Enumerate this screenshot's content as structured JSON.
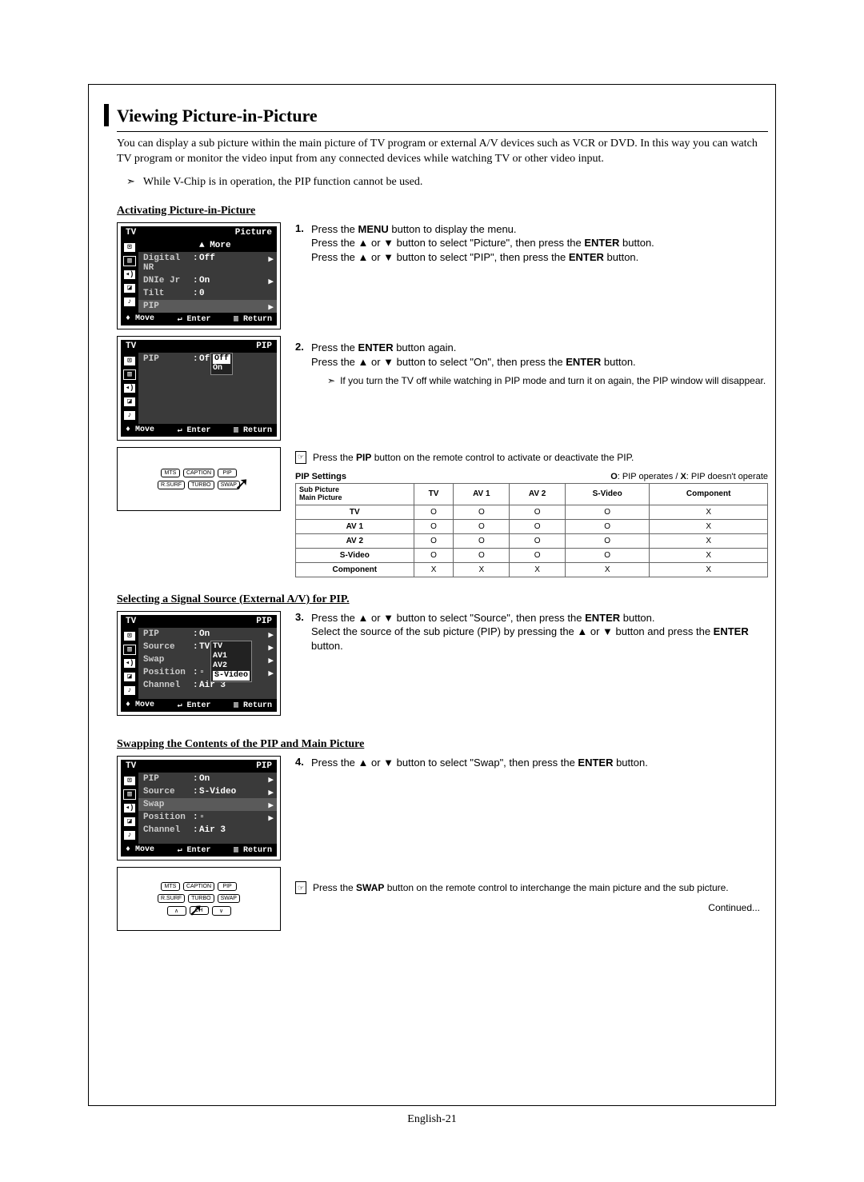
{
  "title": "Viewing Picture-in-Picture",
  "intro": "You can display a sub picture within the main picture of TV program or external A/V devices such as VCR or DVD. In this way you can watch TV program or monitor the video input from any connected devices while watching TV or other video input.",
  "vchip_note": "While V-Chip is in operation, the PIP function cannot be used.",
  "sections": {
    "activating": {
      "heading": "Activating Picture-in-Picture",
      "osd1": {
        "head_left": "TV",
        "head_right": "Picture",
        "rows": [
          {
            "k": "",
            "v": "▲ More",
            "cls": "more"
          },
          {
            "k": "Digital NR",
            "c": ":",
            "v": "Off",
            "arrow": true
          },
          {
            "k": "DNIe Jr",
            "c": ":",
            "v": "On",
            "arrow": true
          },
          {
            "k": "Tilt",
            "c": ":",
            "v": "0"
          },
          {
            "k": "PIP",
            "v": "",
            "arrow": true,
            "cls": "sel"
          }
        ],
        "foot": {
          "move": "♦ Move",
          "enter": "↵ Enter",
          "return": "▥ Return"
        }
      },
      "osd2": {
        "head_left": "TV",
        "head_right": "PIP",
        "rows": [
          {
            "k": "PIP",
            "c": ":",
            "v": "Off",
            "dropdown": [
              "Off",
              "On"
            ],
            "dsel": "Off"
          }
        ],
        "foot": {
          "move": "♦ Move",
          "enter": "↵ Enter",
          "return": "▥ Return"
        }
      },
      "remote1": {
        "r1": [
          "MTS",
          "CAPTION",
          "PIP"
        ],
        "r2": [
          "R.SURF",
          "TURBO",
          "SWAP"
        ]
      },
      "step1": {
        "num": "1.",
        "lines": [
          "Press the <b>MENU</b> button to display the menu.",
          "Press the ▲ or ▼ button to select \"Picture\", then press the <b>ENTER</b> button.",
          "Press the ▲ or ▼ button to select \"PIP\", then press the <b>ENTER</b> button."
        ]
      },
      "step2": {
        "num": "2.",
        "lines": [
          "Press the <b>ENTER</b> button again.",
          "Press the ▲ or ▼ button to select \"On\", then press the <b>ENTER</b> button."
        ],
        "sub": "If you turn the TV off while watching in PIP mode and turn it on again, the PIP window will disappear."
      },
      "remote_note": "Press the <b>PIP</b> button on the remote control to activate or deactivate the PIP.",
      "pip_settings_label": "PIP Settings",
      "pip_settings_legend": "O: PIP operates / X: PIP doesn't operate",
      "pip_table": {
        "corner_top": "Sub Picture",
        "corner_bottom": "Main Picture",
        "cols": [
          "TV",
          "AV 1",
          "AV 2",
          "S-Video",
          "Component"
        ],
        "rows": [
          {
            "h": "TV",
            "cells": [
              "O",
              "O",
              "O",
              "O",
              "X"
            ]
          },
          {
            "h": "AV 1",
            "cells": [
              "O",
              "O",
              "O",
              "O",
              "X"
            ]
          },
          {
            "h": "AV 2",
            "cells": [
              "O",
              "O",
              "O",
              "O",
              "X"
            ]
          },
          {
            "h": "S-Video",
            "cells": [
              "O",
              "O",
              "O",
              "O",
              "X"
            ]
          },
          {
            "h": "Component",
            "cells": [
              "X",
              "X",
              "X",
              "X",
              "X"
            ]
          }
        ]
      }
    },
    "selecting": {
      "heading": "Selecting a Signal Source (External A/V) for PIP",
      "dot": ".",
      "osd": {
        "head_left": "TV",
        "head_right": "PIP",
        "rows": [
          {
            "k": "PIP",
            "c": ":",
            "v": "On",
            "arrow": true
          },
          {
            "k": "Source",
            "c": ":",
            "v": "TV",
            "arrow": true,
            "dropdown": [
              "TV",
              "AV1",
              "AV2",
              "S-Video"
            ],
            "dsel": "S-Video"
          },
          {
            "k": "Swap",
            "v": "",
            "arrow": true
          },
          {
            "k": "Position",
            "c": ":",
            "v": "▫",
            "arrow": true
          },
          {
            "k": "Channel",
            "c": ":",
            "v": "Air  3"
          }
        ],
        "foot": {
          "move": "♦ Move",
          "enter": "↵ Enter",
          "return": "▥ Return"
        }
      },
      "step3": {
        "num": "3.",
        "lines": [
          "Press the ▲ or ▼ button to select \"Source\", then press the <b>ENTER</b> button.",
          "Select the source of the sub picture (PIP) by pressing the ▲ or ▼ button and press the <b>ENTER</b> button."
        ]
      }
    },
    "swapping": {
      "heading": "Swapping the Contents of the PIP and Main Picture",
      "osd": {
        "head_left": "TV",
        "head_right": "PIP",
        "rows": [
          {
            "k": "PIP",
            "c": ":",
            "v": "On",
            "arrow": true
          },
          {
            "k": "Source",
            "c": ":",
            "v": "S-Video",
            "arrow": true
          },
          {
            "k": "Swap",
            "v": "",
            "arrow": true,
            "cls": "sel"
          },
          {
            "k": "Position",
            "c": ":",
            "v": "▫",
            "arrow": true
          },
          {
            "k": "Channel",
            "c": ":",
            "v": "Air  3"
          }
        ],
        "foot": {
          "move": "♦ Move",
          "enter": "↵ Enter",
          "return": "▥ Return"
        }
      },
      "step4": {
        "num": "4.",
        "lines": [
          "Press the ▲ or ▼ button to select \"Swap\", then press the <b>ENTER</b> button."
        ]
      },
      "remote2": {
        "r1": [
          "MTS",
          "CAPTION",
          "PIP"
        ],
        "r2": [
          "R.SURF",
          "TURBO",
          "SWAP"
        ],
        "r3": [
          "∧",
          "CH",
          "∨"
        ]
      },
      "remote_note": "Press the <b>SWAP</b> button on the remote control to interchange the main picture and the sub picture."
    }
  },
  "continued": "Continued...",
  "page_num": "English-21"
}
